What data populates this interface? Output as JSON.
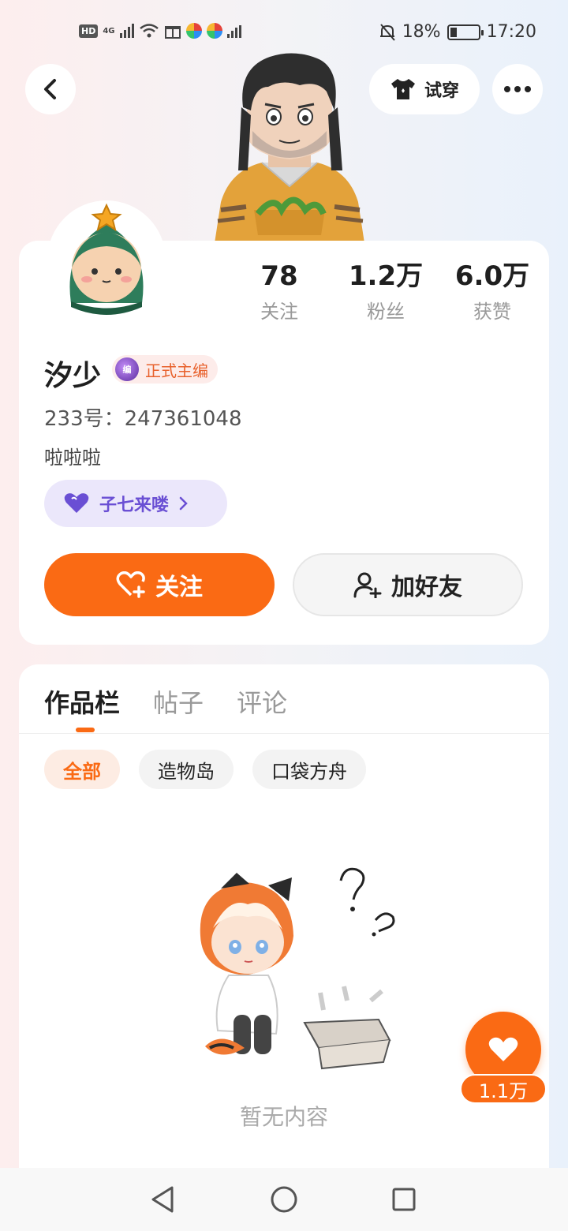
{
  "status_bar": {
    "network": "HD",
    "signal_label": "4G",
    "battery_percent": "18%",
    "time": "17:20"
  },
  "header": {
    "tryon_label": "试穿"
  },
  "profile": {
    "stats": [
      {
        "value": "78",
        "label": "关注"
      },
      {
        "value": "1.2万",
        "label": "粉丝"
      },
      {
        "value": "6.0万",
        "label": "获赞"
      }
    ],
    "name": "汐少",
    "badge_label": "正式主编",
    "badge_icon_text": "编",
    "user_id": "233号：247361048",
    "bio": "啦啦啦",
    "fan_group_label": "子七来喽",
    "follow_label": "关注",
    "add_friend_label": "加好友"
  },
  "content": {
    "tabs": [
      {
        "label": "作品栏",
        "active": true
      },
      {
        "label": "帖子",
        "active": false
      },
      {
        "label": "评论",
        "active": false
      }
    ],
    "chips": [
      {
        "label": "全部",
        "active": true
      },
      {
        "label": "造物岛",
        "active": false
      },
      {
        "label": "口袋方舟",
        "active": false
      }
    ],
    "empty_text": "暂无内容"
  },
  "floating_like": {
    "count": "1.1万"
  },
  "colors": {
    "accent": "#fa6a14",
    "fan_pill": "#6a4fd4"
  }
}
